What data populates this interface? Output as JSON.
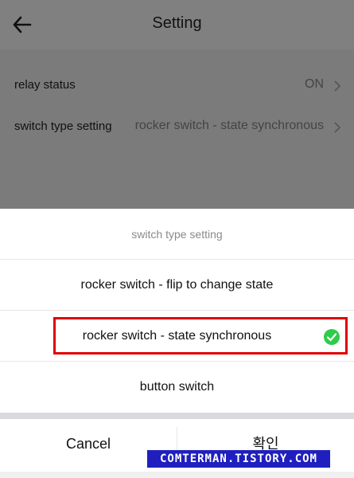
{
  "header": {
    "title": "Setting"
  },
  "settings": [
    {
      "label": "relay status",
      "value": "ON"
    },
    {
      "label": "switch type setting",
      "value": "rocker switch - state synchronous"
    }
  ],
  "sheet": {
    "title": "switch type setting",
    "options": [
      "rocker switch - flip to change state",
      "rocker switch - state synchronous",
      "button switch"
    ],
    "selected": "rocker switch - state synchronous",
    "cancel_label": "Cancel",
    "confirm_label": "확인"
  },
  "watermark": "COMTERMAN.TISTORY.COM",
  "colors": {
    "check": "#2ecc4a",
    "highlight": "#e00000",
    "watermark_bg": "#1f1fbf"
  }
}
